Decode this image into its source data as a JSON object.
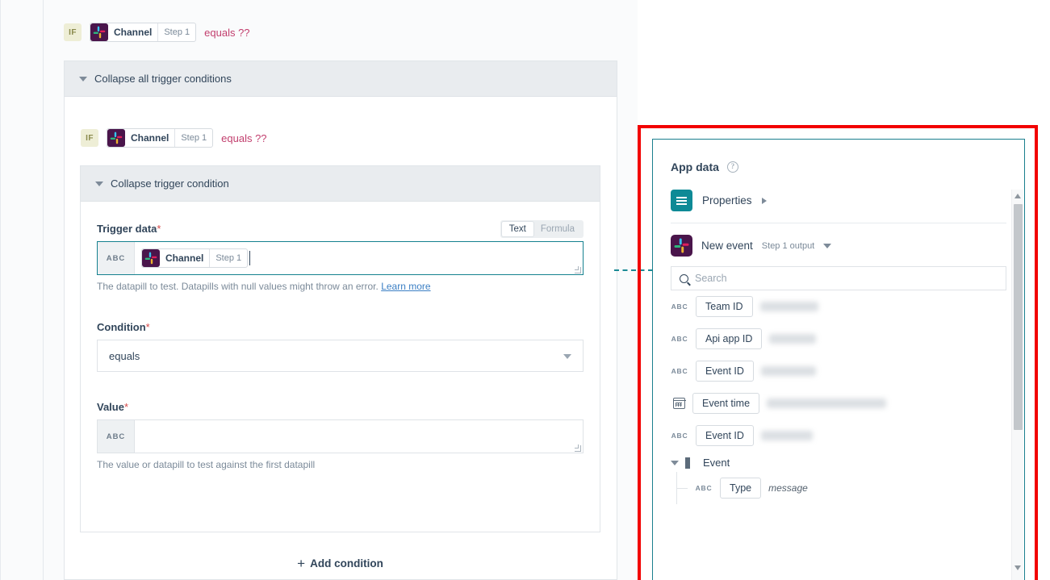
{
  "left": {
    "summary_condition": {
      "if_label": "IF",
      "app_icon": "slack-icon",
      "pill_name": "Channel",
      "pill_step": "Step 1",
      "operator_text": "equals ??"
    },
    "collapse_all_label": "Collapse all trigger conditions",
    "nested_condition": {
      "if_label": "IF",
      "app_icon": "slack-icon",
      "pill_name": "Channel",
      "pill_step": "Step 1",
      "operator_text": "equals ??"
    },
    "collapse_one_label": "Collapse trigger condition",
    "trigger_data": {
      "label": "Trigger data",
      "required_mark": "*",
      "toggle": {
        "text": "Text",
        "formula": "Formula",
        "selected": "Text"
      },
      "type_tag": "ABC",
      "pill_name": "Channel",
      "pill_step": "Step 1",
      "hint": "The datapill to test. Datapills with null values might throw an error.",
      "hint_link": "Learn more"
    },
    "condition": {
      "label": "Condition",
      "required_mark": "*",
      "value": "equals"
    },
    "value_field": {
      "label": "Value",
      "required_mark": "*",
      "type_tag": "ABC",
      "value": "",
      "hint": "The value or datapill to test against the first datapill"
    },
    "add_condition_label": "Add condition",
    "add_condition_icon": "plus-icon"
  },
  "panel": {
    "title": "App data",
    "help_icon": "question-mark-icon",
    "properties": {
      "icon": "list-icon",
      "label": "Properties",
      "expand_icon": "chevron-right-icon"
    },
    "source": {
      "icon": "slack-icon",
      "label": "New event",
      "sublabel": "Step 1 output",
      "dropdown_icon": "chevron-down-icon"
    },
    "search": {
      "icon": "search-icon",
      "placeholder": "Search",
      "value": ""
    },
    "fields": [
      {
        "type_tag": "ABC",
        "icon": "abc-icon",
        "name": "Team ID",
        "value": "",
        "redacted": true,
        "value_width": 72
      },
      {
        "type_tag": "ABC",
        "icon": "abc-icon",
        "name": "Api app ID",
        "value": "",
        "redacted": true,
        "value_width": 58
      },
      {
        "type_tag": "ABC",
        "icon": "abc-icon",
        "name": "Event ID",
        "value": "",
        "redacted": true,
        "value_width": 68
      },
      {
        "type_tag": "",
        "icon": "calendar-icon",
        "name": "Event time",
        "value": "",
        "redacted": true,
        "value_width": 148
      },
      {
        "type_tag": "ABC",
        "icon": "abc-icon",
        "name": "Event ID",
        "value": "",
        "redacted": true,
        "value_width": 64
      }
    ],
    "group": {
      "collapse_icon": "caret-down-icon",
      "icon": "grid-icon",
      "label": "Event",
      "children": [
        {
          "type_tag": "ABC",
          "icon": "abc-icon",
          "name": "Type",
          "value": "message",
          "redacted": false
        }
      ]
    },
    "scrollbar": {
      "up_icon": "scroll-up-arrow-icon",
      "down_icon": "scroll-down-arrow-icon"
    }
  },
  "colors": {
    "highlight": "#f20000",
    "panel_border": "#1a7f8e",
    "accent_teal": "#0e8a96",
    "slack_purple": "#4a154b",
    "operator_pink": "#c23f6e"
  }
}
